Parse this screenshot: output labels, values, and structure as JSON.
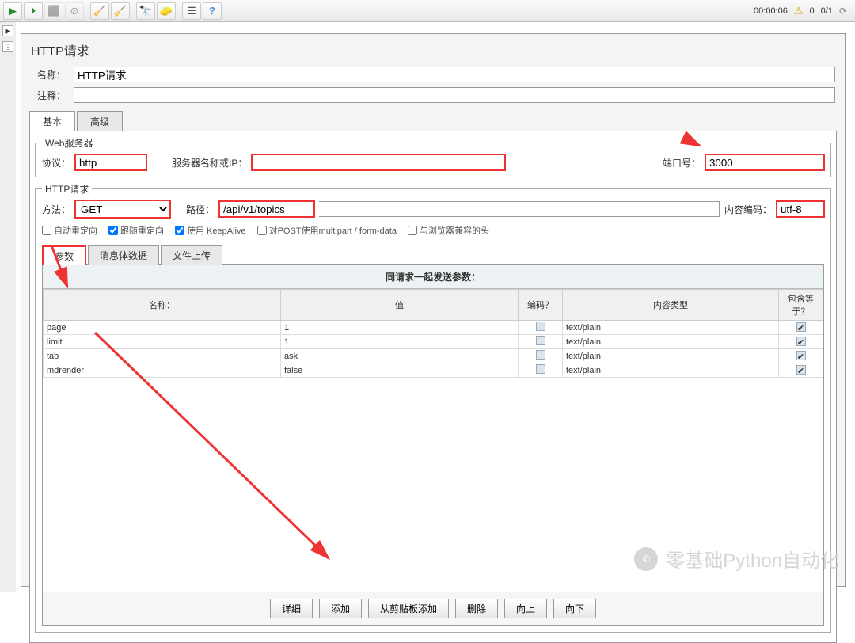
{
  "toolbar": {
    "elapsed": "00:00:06",
    "warnings": "0",
    "progress": "0/1"
  },
  "panel": {
    "title": "HTTP请求",
    "name_label": "名称：",
    "name_value": "HTTP请求",
    "comment_label": "注释：",
    "comment_value": ""
  },
  "tabs": {
    "basic": "基本",
    "advanced": "高级"
  },
  "web_server": {
    "legend": "Web服务器",
    "protocol_label": "协议：",
    "protocol_value": "http",
    "server_label": "服务器名称或IP：",
    "server_value": "",
    "port_label": "端口号：",
    "port_value": "3000"
  },
  "http_request": {
    "legend": "HTTP请求",
    "method_label": "方法：",
    "method_value": "GET",
    "path_label": "路径：",
    "path_value": "/api/v1/topics",
    "encoding_label": "内容编码：",
    "encoding_value": "utf-8"
  },
  "checks": {
    "auto_redirect": "自动重定向",
    "follow_redirect": "跟随重定向",
    "keep_alive": "使用 KeepAlive",
    "multipart": "对POST使用multipart / form-data",
    "browser_headers": "与浏览器兼容的头"
  },
  "sub_tabs": {
    "params": "参数",
    "body": "消息体数据",
    "files": "文件上传"
  },
  "params_section": {
    "title": "同请求一起发送参数：",
    "headers": {
      "name": "名称：",
      "value": "值",
      "encode": "编码？",
      "content_type": "内容类型",
      "include_equals": "包含等于？"
    },
    "rows": [
      {
        "name": "page",
        "value": "1",
        "encode": false,
        "content_type": "text/plain",
        "include_equals": true
      },
      {
        "name": "limit",
        "value": "1",
        "encode": false,
        "content_type": "text/plain",
        "include_equals": true
      },
      {
        "name": "tab",
        "value": "ask",
        "encode": false,
        "content_type": "text/plain",
        "include_equals": true
      },
      {
        "name": "mdrender",
        "value": "false",
        "encode": false,
        "content_type": "text/plain",
        "include_equals": true
      }
    ]
  },
  "buttons": {
    "detail": "详细",
    "add": "添加",
    "add_clipboard": "从剪贴板添加",
    "delete": "删除",
    "up": "向上",
    "down": "向下"
  },
  "watermark": "零基础Python自动化"
}
